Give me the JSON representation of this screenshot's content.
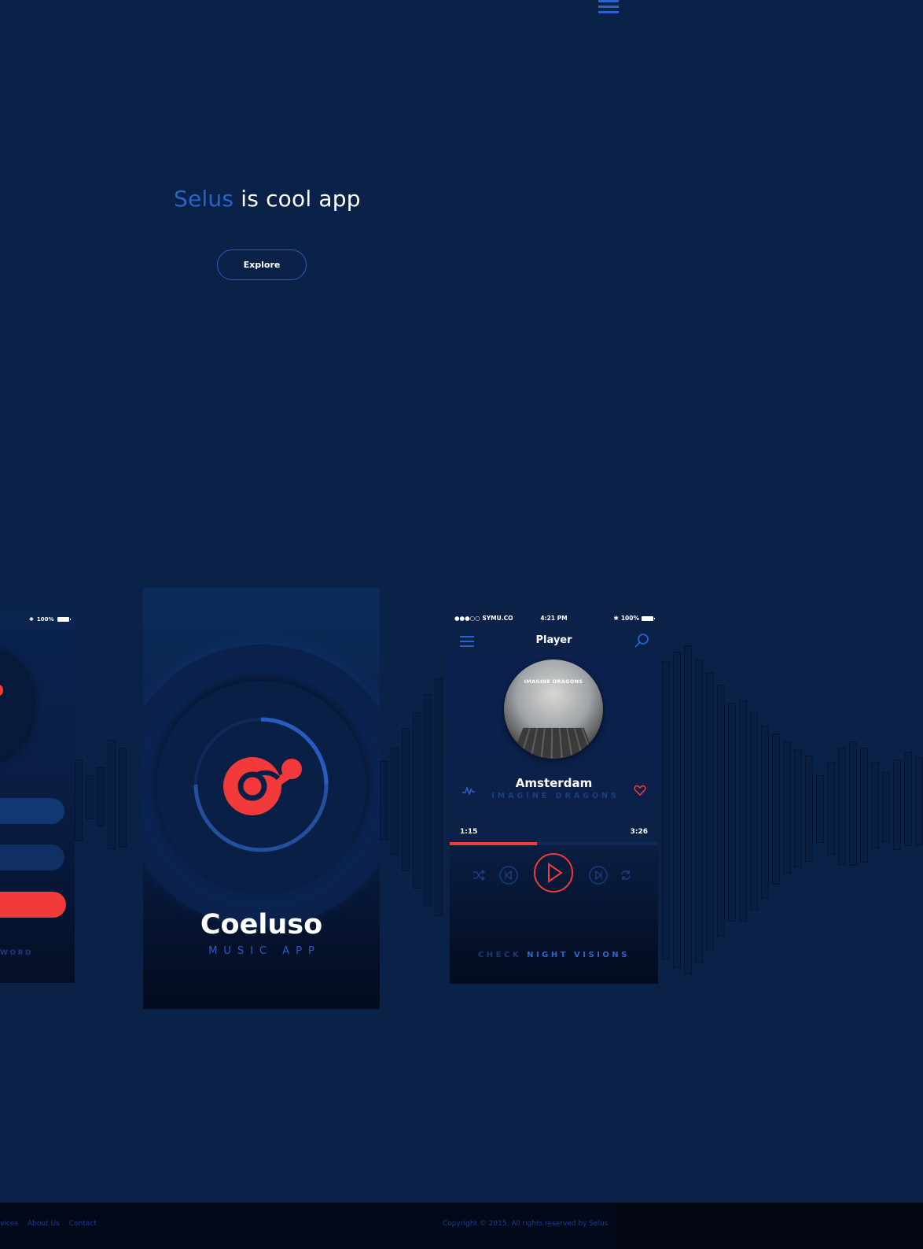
{
  "hero": {
    "brand": "Selus",
    "tagline": " is cool app",
    "explore_label": "Explore"
  },
  "colors": {
    "background": "#0b2248",
    "accent": "#2a62c8",
    "red": "#f33a3a"
  },
  "phone_left": {
    "battery": "100%",
    "forgot_label": "WORD"
  },
  "splash": {
    "title": "Coeluso",
    "subtitle": "MUSIC APP"
  },
  "player": {
    "carrier": "●●●○○ SYMU.CO",
    "time": "4:21 PM",
    "battery": "100%",
    "title": "Player",
    "album_label": "IMAGINE DRAGONS",
    "song": "Amsterdam",
    "artist": "IMAGINE DRAGONS",
    "time_current": "1:15",
    "time_total": "3:26",
    "progress_fraction": 0.42,
    "check_prefix": "CHECK ",
    "check_highlight": "NIGHT VISIONS",
    "icons": [
      "menu-icon",
      "search-icon",
      "pulse-icon",
      "heart-icon",
      "shuffle-icon",
      "previous-icon",
      "play-icon",
      "next-icon",
      "repeat-icon"
    ]
  },
  "footer": {
    "links": [
      "vices",
      "About Us",
      "Contact"
    ],
    "copyright": "Copyright © 2015, All rights reserved by Selus"
  }
}
